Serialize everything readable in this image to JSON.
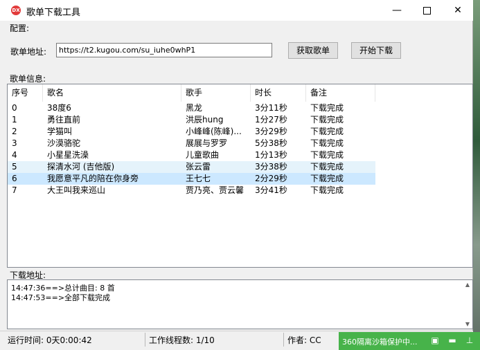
{
  "window": {
    "title": "歌单下载工具",
    "app_icon_text": "DX",
    "minimize": "—",
    "close": "✕"
  },
  "config": {
    "section_label": "配置:",
    "url_label": "歌单地址:",
    "url_value": "https://t2.kugou.com/su_iuhe0whP1",
    "fetch_button": "获取歌单",
    "start_button": "开始下载"
  },
  "playlist": {
    "section_label": "歌单信息:",
    "columns": [
      "序号",
      "歌名",
      "歌手",
      "时长",
      "备注"
    ],
    "rows": [
      {
        "index": "0",
        "name": "38度6",
        "artist": "黑龙",
        "duration": "3分11秒",
        "note": "下载完成"
      },
      {
        "index": "1",
        "name": "勇往直前",
        "artist": "洪辰hung",
        "duration": "1分27秒",
        "note": "下载完成"
      },
      {
        "index": "2",
        "name": "学猫叫",
        "artist": "小峰峰(陈峰)...",
        "duration": "3分29秒",
        "note": "下载完成"
      },
      {
        "index": "3",
        "name": "沙漠骆驼",
        "artist": "展展与罗罗",
        "duration": "5分38秒",
        "note": "下载完成"
      },
      {
        "index": "4",
        "name": "小星星洗澡",
        "artist": "儿童歌曲",
        "duration": "1分13秒",
        "note": "下载完成"
      },
      {
        "index": "5",
        "name": "探清水河 (吉他版)",
        "artist": "张云雷",
        "duration": "3分38秒",
        "note": "下载完成"
      },
      {
        "index": "6",
        "name": "我愿意平凡的陪在你身旁",
        "artist": "王七七",
        "duration": "2分29秒",
        "note": "下载完成"
      },
      {
        "index": "7",
        "name": "大王叫我来巡山",
        "artist": "贾乃亮、贾云馨",
        "duration": "3分41秒",
        "note": "下载完成"
      }
    ]
  },
  "download": {
    "section_label": "下载地址:",
    "log": [
      "14:47:36==>总计曲目: 8 首",
      "14:47:53==>全部下载完成"
    ]
  },
  "status": {
    "runtime": "运行时间:  0天0:00:42",
    "threads": "工作线程数:  1/10",
    "author": "作者:  CC"
  },
  "sandbox": {
    "text": "360隔离沙箱保护中..."
  }
}
